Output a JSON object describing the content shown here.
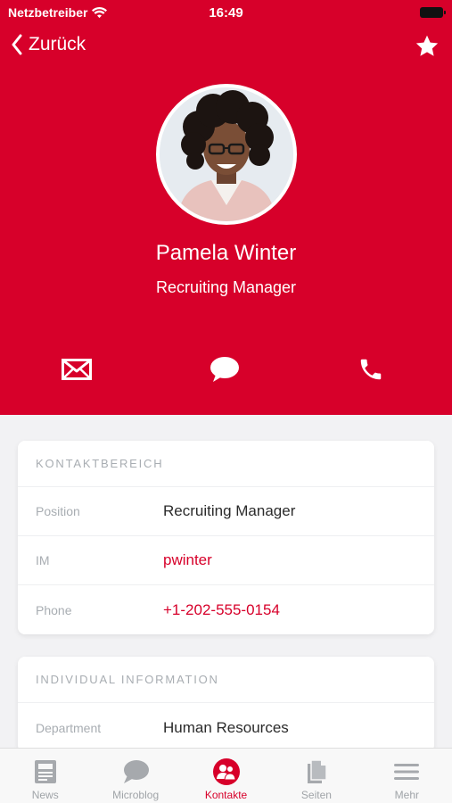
{
  "status_bar": {
    "carrier": "Netzbetreiber",
    "time": "16:49"
  },
  "nav": {
    "back_label": "Zurück",
    "favorite_icon": "star-icon"
  },
  "profile": {
    "name": "Pamela Winter",
    "title": "Recruiting Manager"
  },
  "actions": [
    {
      "name": "email",
      "icon": "envelope-icon"
    },
    {
      "name": "chat",
      "icon": "chat-bubble-icon"
    },
    {
      "name": "call",
      "icon": "phone-icon"
    }
  ],
  "contact_section": {
    "title": "KONTAKTBEREICH",
    "rows": [
      {
        "label": "Position",
        "value": "Recruiting Manager"
      },
      {
        "label": "IM",
        "value": "pwinter"
      },
      {
        "label": "Phone",
        "value": "+1-202-555-0154"
      }
    ]
  },
  "individual_section": {
    "title": "INDIVIDUAL INFORMATION",
    "rows": [
      {
        "label": "Department",
        "value": "Human Resources"
      }
    ]
  },
  "tabs": [
    {
      "label": "News",
      "icon": "newspaper-icon"
    },
    {
      "label": "Microblog",
      "icon": "speech-bubble-icon"
    },
    {
      "label": "Kontakte",
      "icon": "contacts-icon",
      "active": true
    },
    {
      "label": "Seiten",
      "icon": "pages-icon"
    },
    {
      "label": "Mehr",
      "icon": "menu-icon"
    }
  ],
  "colors": {
    "accent": "#d7002a",
    "background": "#f2f2f4",
    "muted_text": "#a8adb2"
  }
}
